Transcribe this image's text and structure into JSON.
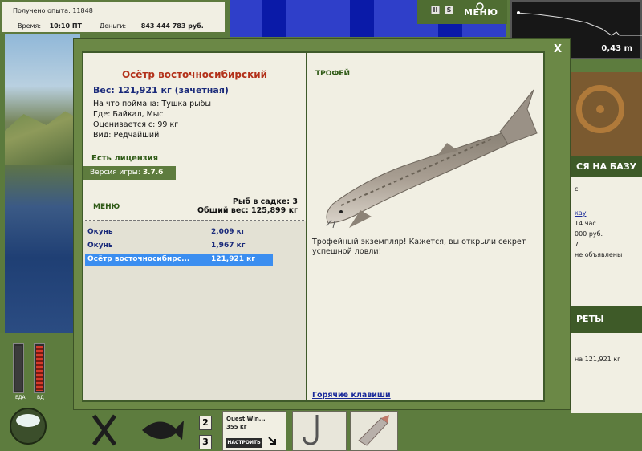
{
  "hud": {
    "xp_label": "Получено опыта:",
    "xp_value": "11848",
    "time_label": "Время:",
    "time_value": "10:10 ПТ",
    "money_label": "Деньги:",
    "money_value": "843 444 783 руб."
  },
  "topbar": {
    "pause_label": "II",
    "settings_label": "S",
    "menu_label": "МЕНЮ"
  },
  "depth": {
    "value": "0,43 m"
  },
  "right_side": {
    "return_label": "СЯ НА БАЗУ",
    "info_lines": [
      "с",
      "",
      "кау",
      "14 час.",
      "000 руб.",
      "7",
      "не объявлены"
    ],
    "secrets_label": "РЕТЫ",
    "record_text": "на 121,921 кг"
  },
  "gauges": {
    "food_label": "ЕДА",
    "bait_label": "ВД"
  },
  "slots": {
    "num_2": "2",
    "num_3": "3",
    "quest_title": "Quest Win...",
    "quest_weight": "355 кг",
    "setup_label": "НАСТРОИТЬ"
  },
  "modal": {
    "close_label": "X",
    "fish": {
      "name": "Осётр восточносибирский",
      "weight": "Вес: 121,921 кг (зачетная)",
      "caught_on": "На что поймана: Тушка рыбы",
      "location": "Где: Байкал, Мыс",
      "valued": "Оценивается с: 99 кг",
      "kind": "Вид: Редчайший"
    },
    "license": "Есть лицензия",
    "version_label": "Версия игры:",
    "version_value": "3.7.6",
    "menu_label": "МЕНЮ",
    "keep_count": "Рыб в садке: 3",
    "total_weight": "Общий вес: 125,899 кг",
    "catches": [
      {
        "name": "Окунь",
        "weight": "2,009 кг"
      },
      {
        "name": "Окунь",
        "weight": "1,967 кг"
      },
      {
        "name": "Осётр восточносибирс...",
        "weight": "121,921 кг"
      }
    ],
    "selected_index": 2,
    "trophy_label": "ТРОФЕЙ",
    "trophy_message": "Трофейный экземпляр! Кажется, вы открыли секрет успешной ловли!",
    "hotkeys_link": "Горячие клавиши"
  },
  "colors": {
    "accent_green": "#5e7c3e",
    "title_red": "#b3311a",
    "selection_blue": "#3b8ef0",
    "paper": "#f1efe3"
  },
  "icons": [
    "close-icon",
    "ship-wheel-icon",
    "sturgeon-image",
    "cauldron-icon",
    "hook-icon",
    "fish-bait-icon",
    "arrow-icon"
  ]
}
